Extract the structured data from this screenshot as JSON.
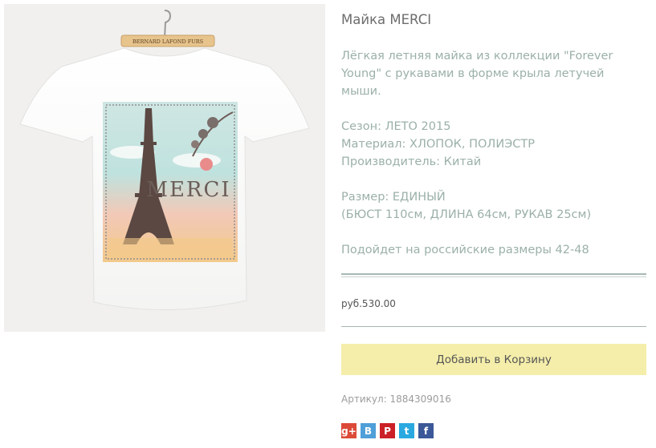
{
  "product": {
    "title": "Майка MERCI",
    "description_lines": [
      "Лёгкая летняя майка из коллекции \"Forever Young\" с рукавами в форме крыла летучей мыши."
    ],
    "specs": {
      "season": "Сезон: ЛЕТО 2015",
      "material": "Материал: ХЛОПОК, ПОЛИЭСТР",
      "maker": "Производитель: Китай"
    },
    "size": {
      "line1": "Размер: ЕДИНЫЙ",
      "line2": "(БЮСТ 110см, ДЛИНА 64см, РУКАВ 25см)"
    },
    "fit_note": "Подойдет на российские размеры 42-48",
    "price": "руб.530.00",
    "add_to_cart_label": "Добавить в Корзину",
    "sku": "Артикул: 1884309016"
  },
  "image": {
    "hanger_text": "BERNARD LAFOND FURS",
    "print_text": "MERCI"
  },
  "social": [
    {
      "name": "google-plus",
      "glyph": "g+",
      "color": "#dc4a38"
    },
    {
      "name": "vkontakte",
      "glyph": "В",
      "color": "#4f9fd8"
    },
    {
      "name": "pinterest",
      "glyph": "P",
      "color": "#cb2027"
    },
    {
      "name": "twitter",
      "glyph": "t",
      "color": "#2aa9e0"
    },
    {
      "name": "facebook",
      "glyph": "f",
      "color": "#3b5998"
    }
  ]
}
